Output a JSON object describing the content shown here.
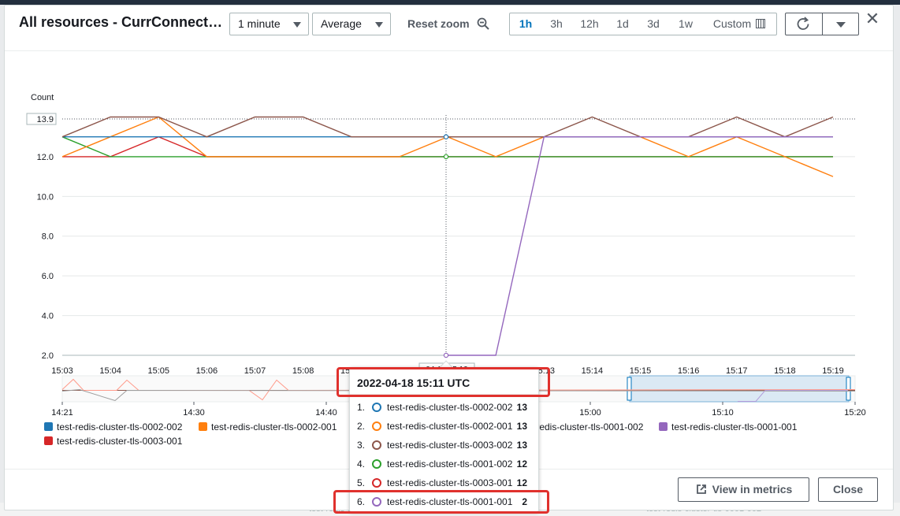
{
  "modal": {
    "title": "All resources - CurrConnections",
    "period_select": "1 minute",
    "stat_select": "Average",
    "reset_zoom": "Reset zoom",
    "ranges": [
      "1h",
      "3h",
      "12h",
      "1d",
      "3d",
      "1w",
      "Custom"
    ],
    "active_range": "1h",
    "view_in_metrics": "View in metrics",
    "close": "Close"
  },
  "chart_data": {
    "type": "line",
    "ylabel": "Count",
    "ylim": [
      2.0,
      13.9
    ],
    "yticks": [
      "2.0",
      "4.0",
      "6.0",
      "8.0",
      "10.0",
      "12.0",
      "13.9"
    ],
    "x": [
      "15:03",
      "15:04",
      "15:05",
      "15:06",
      "15:07",
      "15:08",
      "15:09",
      "15:10",
      "15:11",
      "15:12",
      "15:13",
      "15:14",
      "15:15",
      "15:16",
      "15:17",
      "15:18",
      "15:19"
    ],
    "xticks": [
      "15:03",
      "15:04",
      "15:05",
      "15:06",
      "15:07",
      "15:08",
      "15:09",
      "15:10",
      "15:11",
      "15:12",
      "15:13",
      "15:14",
      "15:15",
      "15:16",
      "15:17",
      "15:18",
      "15:19"
    ],
    "series": [
      {
        "name": "test-redis-cluster-tls-0002-002",
        "color": "#1f77b4",
        "points": [
          [
            "15:03",
            13
          ],
          [
            "15:05",
            13
          ],
          [
            "15:06",
            13
          ],
          [
            "15:09",
            13
          ],
          [
            "15:10",
            13
          ],
          [
            "15:11",
            13
          ],
          [
            "15:12",
            13
          ],
          [
            "15:13",
            13
          ],
          [
            "15:19",
            13
          ]
        ]
      },
      {
        "name": "test-redis-cluster-tls-0002-001",
        "color": "#ff7f0e",
        "points": [
          [
            "15:03",
            12
          ],
          [
            "15:04",
            13
          ],
          [
            "15:05",
            14
          ],
          [
            "15:06",
            12
          ],
          [
            "15:09",
            12
          ],
          [
            "15:10",
            12
          ],
          [
            "15:11",
            13
          ],
          [
            "15:12",
            12
          ],
          [
            "15:13",
            13
          ],
          [
            "15:14",
            13
          ],
          [
            "15:15",
            13
          ],
          [
            "15:16",
            12
          ],
          [
            "15:17",
            13
          ],
          [
            "15:18",
            12
          ],
          [
            "15:19",
            11
          ]
        ]
      },
      {
        "name": "test-redis-cluster-tls-0003-002",
        "color": "#8c564b",
        "points": [
          [
            "15:03",
            13
          ],
          [
            "15:04",
            14
          ],
          [
            "15:05",
            14
          ],
          [
            "15:06",
            13
          ],
          [
            "15:07",
            14
          ],
          [
            "15:08",
            14
          ],
          [
            "15:09",
            13
          ],
          [
            "15:10",
            13
          ],
          [
            "15:11",
            13
          ],
          [
            "15:12",
            13
          ],
          [
            "15:13",
            13
          ],
          [
            "15:14",
            14
          ],
          [
            "15:15",
            13
          ],
          [
            "15:16",
            13
          ],
          [
            "15:17",
            14
          ],
          [
            "15:18",
            13
          ],
          [
            "15:19",
            14
          ]
        ]
      },
      {
        "name": "test-redis-cluster-tls-0001-002",
        "color": "#2ca02c",
        "points": [
          [
            "15:03",
            13
          ],
          [
            "15:04",
            12
          ],
          [
            "15:05",
            12
          ],
          [
            "15:06",
            12
          ],
          [
            "15:19",
            12
          ]
        ]
      },
      {
        "name": "test-redis-cluster-tls-0003-001",
        "color": "#d62728",
        "points": [
          [
            "15:03",
            12
          ],
          [
            "15:04",
            12
          ],
          [
            "15:05",
            13
          ],
          [
            "15:06",
            12
          ],
          [
            "15:19",
            12
          ]
        ]
      },
      {
        "name": "test-redis-cluster-tls-0001-001",
        "color": "#9467bd",
        "points": [
          [
            "15:11",
            2
          ],
          [
            "15:12",
            2
          ],
          [
            "15:13",
            13
          ],
          [
            "15:19",
            13
          ]
        ]
      }
    ],
    "crosshair_x": "15:11",
    "crosshair_label": "04-18 15:10",
    "overview_ticks": [
      "14:21",
      "14:30",
      "14:40",
      "15:00",
      "15:10",
      "15:20"
    ],
    "grid": true,
    "legend_position": "bottom"
  },
  "tooltip": {
    "title": "2022-04-18 15:11 UTC",
    "rows": [
      {
        "idx": "1.",
        "name": "test-redis-cluster-tls-0002-002",
        "value": "13",
        "color": "#1f77b4"
      },
      {
        "idx": "2.",
        "name": "test-redis-cluster-tls-0002-001",
        "value": "13",
        "color": "#ff7f0e"
      },
      {
        "idx": "3.",
        "name": "test-redis-cluster-tls-0003-002",
        "value": "13",
        "color": "#8c564b"
      },
      {
        "idx": "4.",
        "name": "test-redis-cluster-tls-0001-002",
        "value": "12",
        "color": "#2ca02c"
      },
      {
        "idx": "5.",
        "name": "test-redis-cluster-tls-0003-001",
        "value": "12",
        "color": "#d62728"
      },
      {
        "idx": "6.",
        "name": "test-redis-cluster-tls-0001-001",
        "value": "2",
        "color": "#9467bd"
      }
    ]
  },
  "background": {
    "footer_left": "test-redis-cluster-tls-0001-001",
    "footer_right": "test-redis-cluster-tls-0001-002"
  }
}
